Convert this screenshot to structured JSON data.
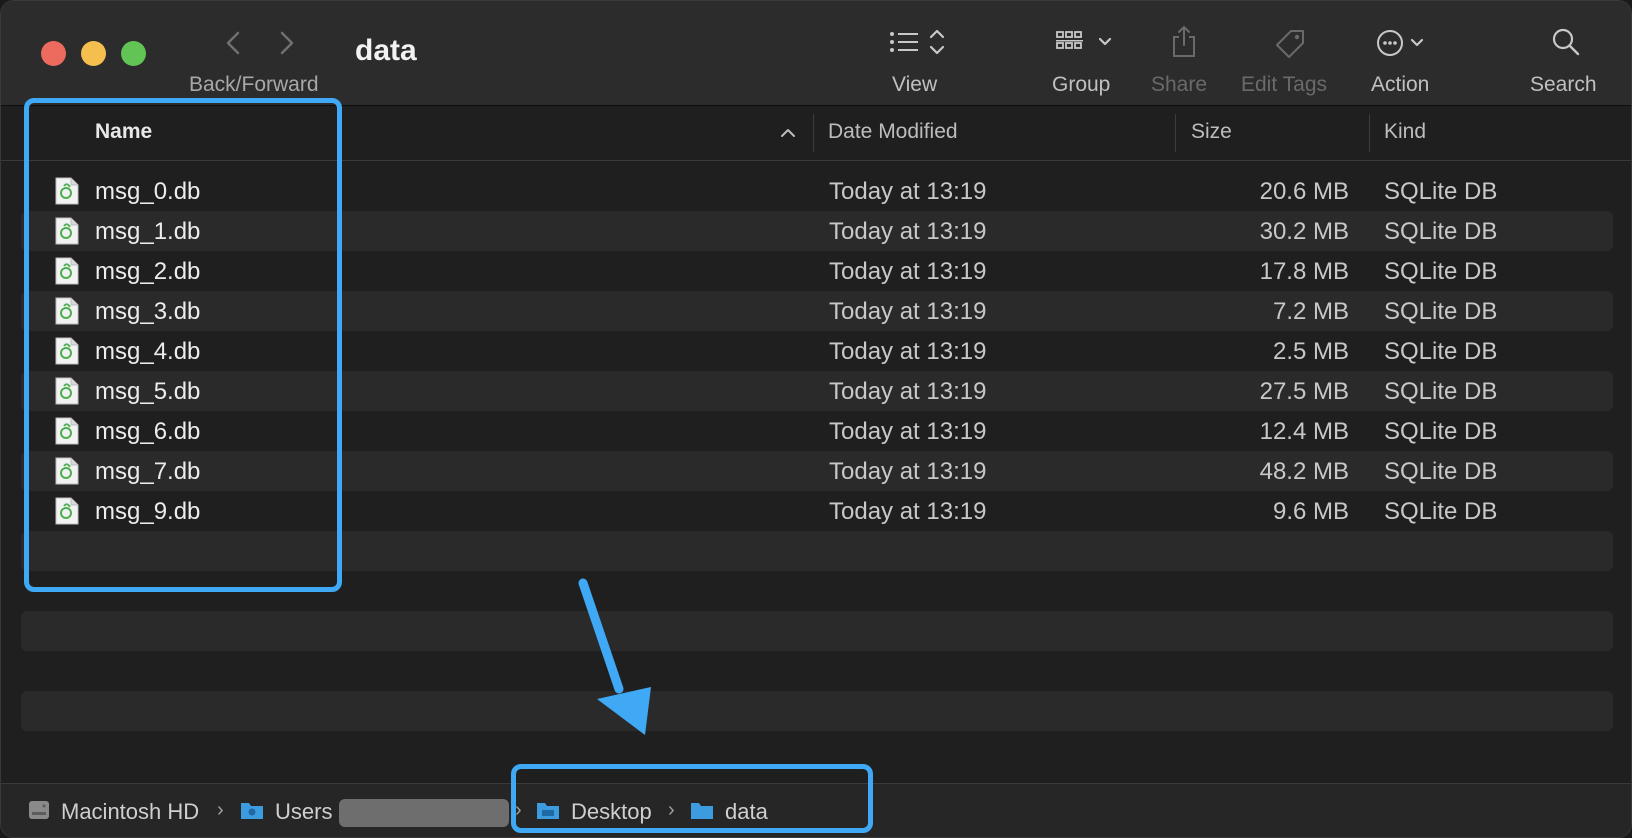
{
  "window": {
    "title": "data"
  },
  "toolbar": {
    "back_forward_label": "Back/Forward",
    "view_label": "View",
    "group_label": "Group",
    "share_label": "Share",
    "edit_tags_label": "Edit Tags",
    "action_label": "Action",
    "search_label": "Search"
  },
  "columns": {
    "name": "Name",
    "date_modified": "Date Modified",
    "size": "Size",
    "kind": "Kind"
  },
  "files": [
    {
      "name": "msg_0.db",
      "date": "Today at 13:19",
      "size": "20.6 MB",
      "kind": "SQLite DB"
    },
    {
      "name": "msg_1.db",
      "date": "Today at 13:19",
      "size": "30.2 MB",
      "kind": "SQLite DB"
    },
    {
      "name": "msg_2.db",
      "date": "Today at 13:19",
      "size": "17.8 MB",
      "kind": "SQLite DB"
    },
    {
      "name": "msg_3.db",
      "date": "Today at 13:19",
      "size": "7.2 MB",
      "kind": "SQLite DB"
    },
    {
      "name": "msg_4.db",
      "date": "Today at 13:19",
      "size": "2.5 MB",
      "kind": "SQLite DB"
    },
    {
      "name": "msg_5.db",
      "date": "Today at 13:19",
      "size": "27.5 MB",
      "kind": "SQLite DB"
    },
    {
      "name": "msg_6.db",
      "date": "Today at 13:19",
      "size": "12.4 MB",
      "kind": "SQLite DB"
    },
    {
      "name": "msg_7.db",
      "date": "Today at 13:19",
      "size": "48.2 MB",
      "kind": "SQLite DB"
    },
    {
      "name": "msg_9.db",
      "date": "Today at 13:19",
      "size": "9.6 MB",
      "kind": "SQLite DB"
    }
  ],
  "pathbar": {
    "disk": "Macintosh HD",
    "users": "Users",
    "desktop": "Desktop",
    "data": "data"
  },
  "colors": {
    "annotation": "#3fa9f5",
    "file_icon_accent": "#4caf50"
  },
  "icons": {
    "file": "sqlite-file-icon",
    "folder": "folder-icon",
    "disk": "hard-disk-icon"
  }
}
